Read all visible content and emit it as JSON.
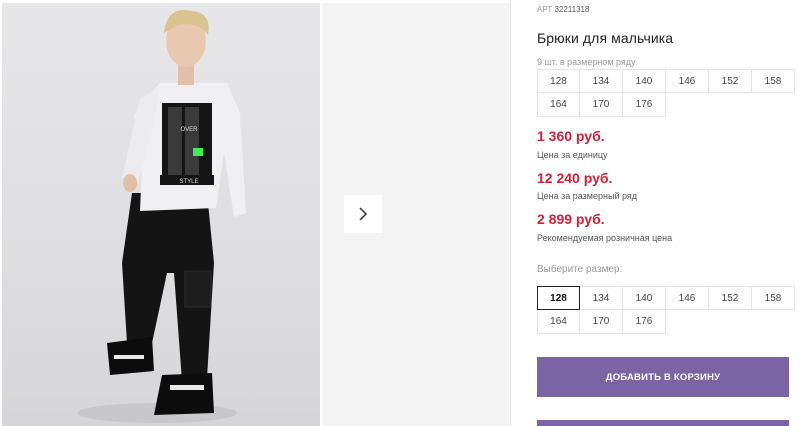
{
  "product": {
    "art_label": "АРТ",
    "art_number": "32211318",
    "title": "Брюки для мальчика",
    "series_note": "9 шт. в размерном ряду",
    "series_sizes": [
      "128",
      "134",
      "140",
      "146",
      "152",
      "158",
      "164",
      "170",
      "176"
    ]
  },
  "prices": [
    {
      "value": "1 360 руб.",
      "label": "Цена за единицу"
    },
    {
      "value": "12 240 руб.",
      "label": "Цена за размерный ряд"
    },
    {
      "value": "2 899 руб.",
      "label": "Рекомендуемая розничная цена"
    }
  ],
  "size_picker": {
    "label": "Выберите размер:",
    "sizes": [
      "128",
      "134",
      "140",
      "146",
      "152",
      "158",
      "164",
      "170",
      "176"
    ],
    "selected": "128"
  },
  "cart": {
    "button_label": "ДОБАВИТЬ В КОРЗИНУ"
  },
  "gallery": {
    "next_icon": "chevron-right-icon",
    "shirt_print_words": [
      "OVER",
      "STYLE"
    ]
  },
  "colors": {
    "price_red": "#d0203a",
    "button_purple": "#7a64a3",
    "print_green": "#3df05a"
  }
}
